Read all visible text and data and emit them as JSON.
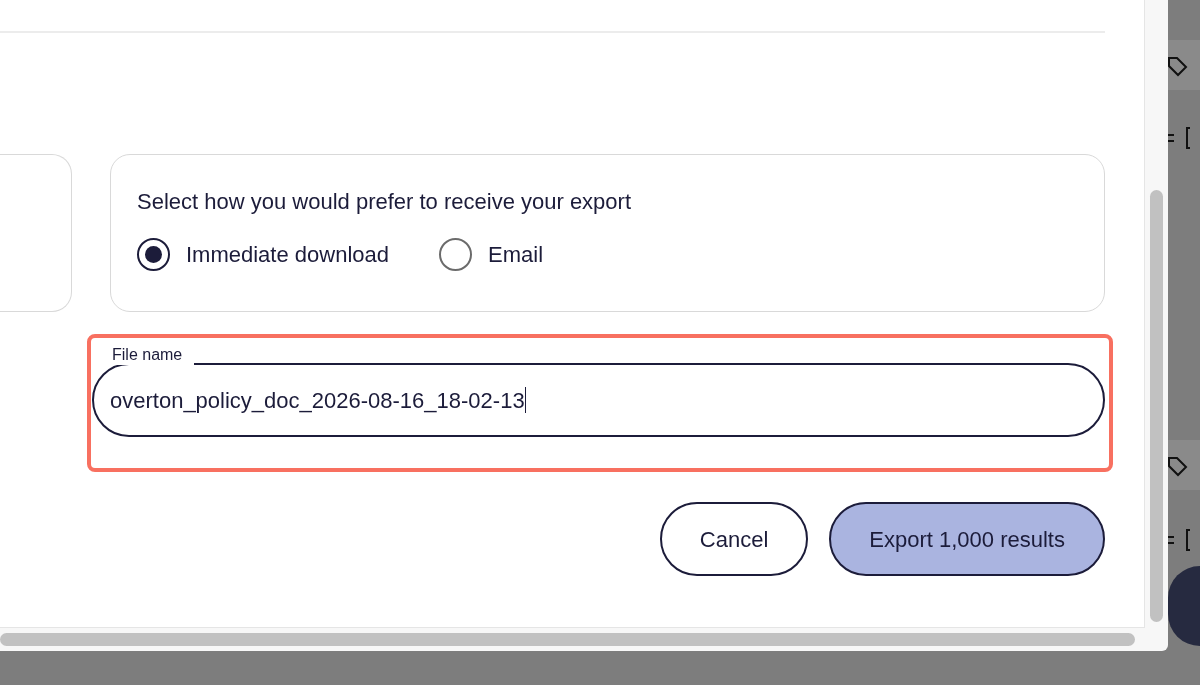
{
  "export_method": {
    "prompt": "Select how you would prefer to receive your export",
    "options": [
      {
        "label": "Immediate download",
        "selected": true
      },
      {
        "label": "Email",
        "selected": false
      }
    ]
  },
  "file_name": {
    "label": "File name",
    "value": "overton_policy_doc_2026-08-16_18-02-13",
    "focused": true
  },
  "buttons": [
    {
      "label": "Cancel",
      "kind": "secondary"
    },
    {
      "label": "Export 1,000 results",
      "kind": "primary"
    }
  ]
}
